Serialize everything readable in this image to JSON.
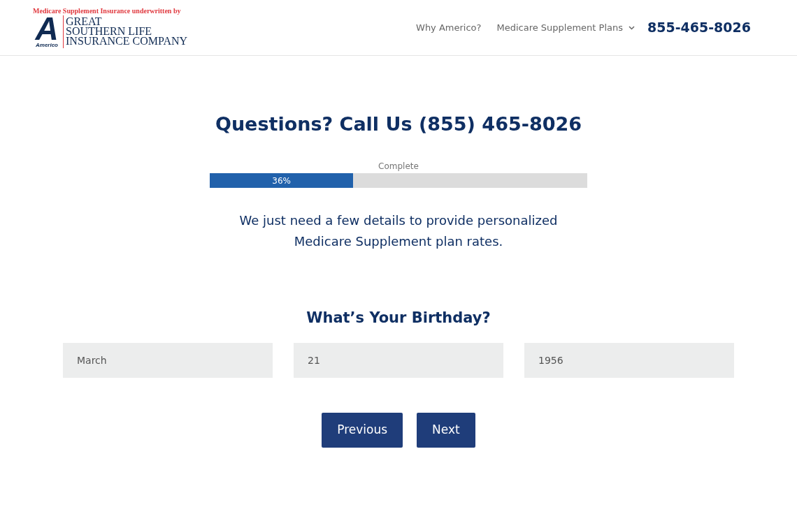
{
  "header": {
    "logo": {
      "tagline": "Medicare Supplement Insurance underwritten by",
      "mark": "A",
      "mark_caption": "Americo",
      "company_lines": [
        "GREAT",
        "SOUTHERN LIFE",
        "INSURANCE COMPANY"
      ]
    },
    "nav": [
      {
        "label": "Why Americo?",
        "dropdown": false
      },
      {
        "label": "Medicare Supplement Plans",
        "dropdown": true
      }
    ],
    "phone": "855-465-8026"
  },
  "heading": "Questions? Call Us (855) 465-8026",
  "progress": {
    "caption": "Complete",
    "level": 0.38,
    "reading": "36%"
  },
  "intro": "We just need a few details to provide personalized Medicare Supplement plan rates.",
  "question": "What’s Your Birthday?",
  "fields": [
    {
      "value": "March"
    },
    {
      "value": "21"
    },
    {
      "value": "1956"
    }
  ],
  "buttons": [
    {
      "label": "Previous"
    },
    {
      "label": "Next"
    }
  ]
}
